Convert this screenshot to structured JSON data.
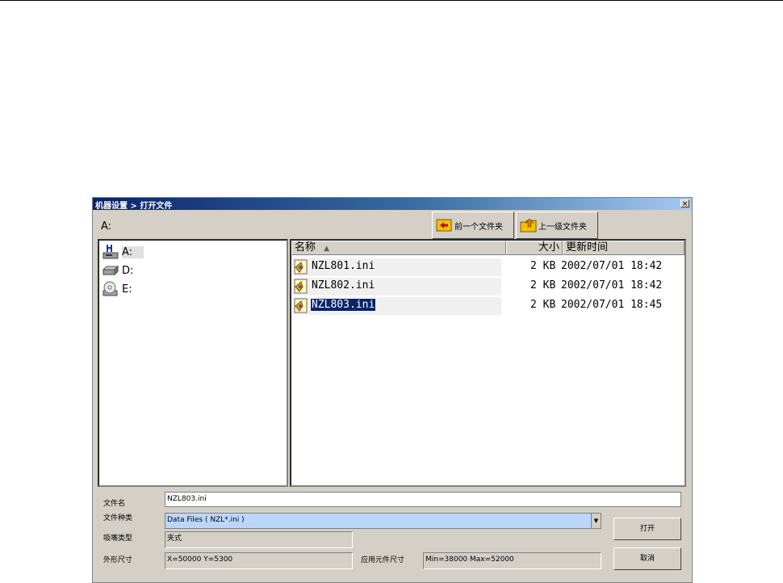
{
  "dialog": {
    "title": "机器设置 > 打开文件",
    "close_glyph": "×",
    "current_path": "A:"
  },
  "toolbar": {
    "back_label": "前一个文件夹",
    "up_label": "上一级文件夹"
  },
  "drives": [
    {
      "label": "A:",
      "icon": "floppy-drive-icon",
      "selected": true
    },
    {
      "label": "D:",
      "icon": "hard-drive-icon"
    },
    {
      "label": "E:",
      "icon": "cd-drive-icon"
    }
  ],
  "file_list": {
    "columns": {
      "name": "名称",
      "sort_glyph": "▲",
      "size": "大小",
      "modified": "更新时间"
    },
    "rows": [
      {
        "name": "NZL801.ini",
        "size": "2 KB",
        "modified": "2002/07/01 18:42",
        "selected": false
      },
      {
        "name": "NZL802.ini",
        "size": "2 KB",
        "modified": "2002/07/01 18:42",
        "selected": false
      },
      {
        "name": "NZL803.ini",
        "size": "2 KB",
        "modified": "2002/07/01 18:45",
        "selected": true
      }
    ]
  },
  "form": {
    "filename_label": "文件名",
    "filename_value": "NZL803.ini",
    "filetype_label": "文件种类",
    "filetype_value": "Data Files ( NZL*.ini )",
    "combo_arrow": "▼",
    "head_type_label": "吸嘴类型",
    "head_type_value": "夹式",
    "size_label": "外形尺寸",
    "size_value": "X=50000 Y=5300",
    "component_label": "应用元件尺寸",
    "component_value": "Min=38000 Max=52000"
  },
  "buttons": {
    "open_label": "打开",
    "cancel_label": "取消"
  }
}
